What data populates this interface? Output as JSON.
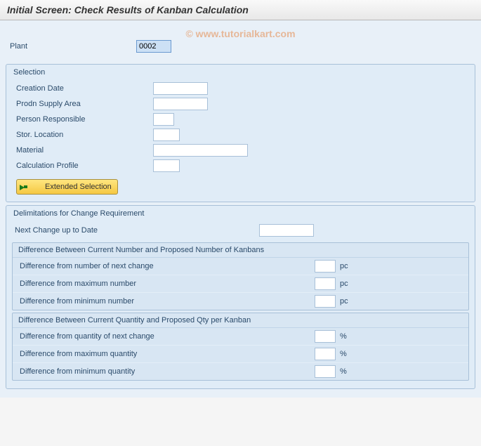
{
  "title": "Initial Screen: Check Results of Kanban Calculation",
  "watermark": "© www.tutorialkart.com",
  "plant": {
    "label": "Plant",
    "value": "0002"
  },
  "selection": {
    "title": "Selection",
    "creation_date": {
      "label": "Creation Date",
      "value": ""
    },
    "supply_area": {
      "label": "Prodn Supply Area",
      "value": ""
    },
    "responsible": {
      "label": "Person Responsible",
      "value": ""
    },
    "stor_loc": {
      "label": "Stor. Location",
      "value": ""
    },
    "material": {
      "label": "Material",
      "value": ""
    },
    "calc_profile": {
      "label": "Calculation Profile",
      "value": ""
    },
    "extended_btn": "Extended Selection"
  },
  "delim": {
    "title": "Delimitations for Change Requirement",
    "next_change": {
      "label": "Next Change up to Date",
      "value": ""
    },
    "number": {
      "title": "Difference Between Current Number and Proposed Number of Kanbans",
      "next": {
        "label": "Difference from number of next change",
        "value": "",
        "unit": "pc"
      },
      "max": {
        "label": "Difference from maximum number",
        "value": "",
        "unit": "pc"
      },
      "min": {
        "label": "Difference from minimum number",
        "value": "",
        "unit": "pc"
      }
    },
    "qty": {
      "title": "Difference Between Current Quantity and Proposed Qty per Kanban",
      "next": {
        "label": "Difference from quantity of next change",
        "value": "",
        "unit": "%"
      },
      "max": {
        "label": "Difference from maximum quantity",
        "value": "",
        "unit": "%"
      },
      "min": {
        "label": "Difference from minimum quantity",
        "value": "",
        "unit": "%"
      }
    }
  }
}
